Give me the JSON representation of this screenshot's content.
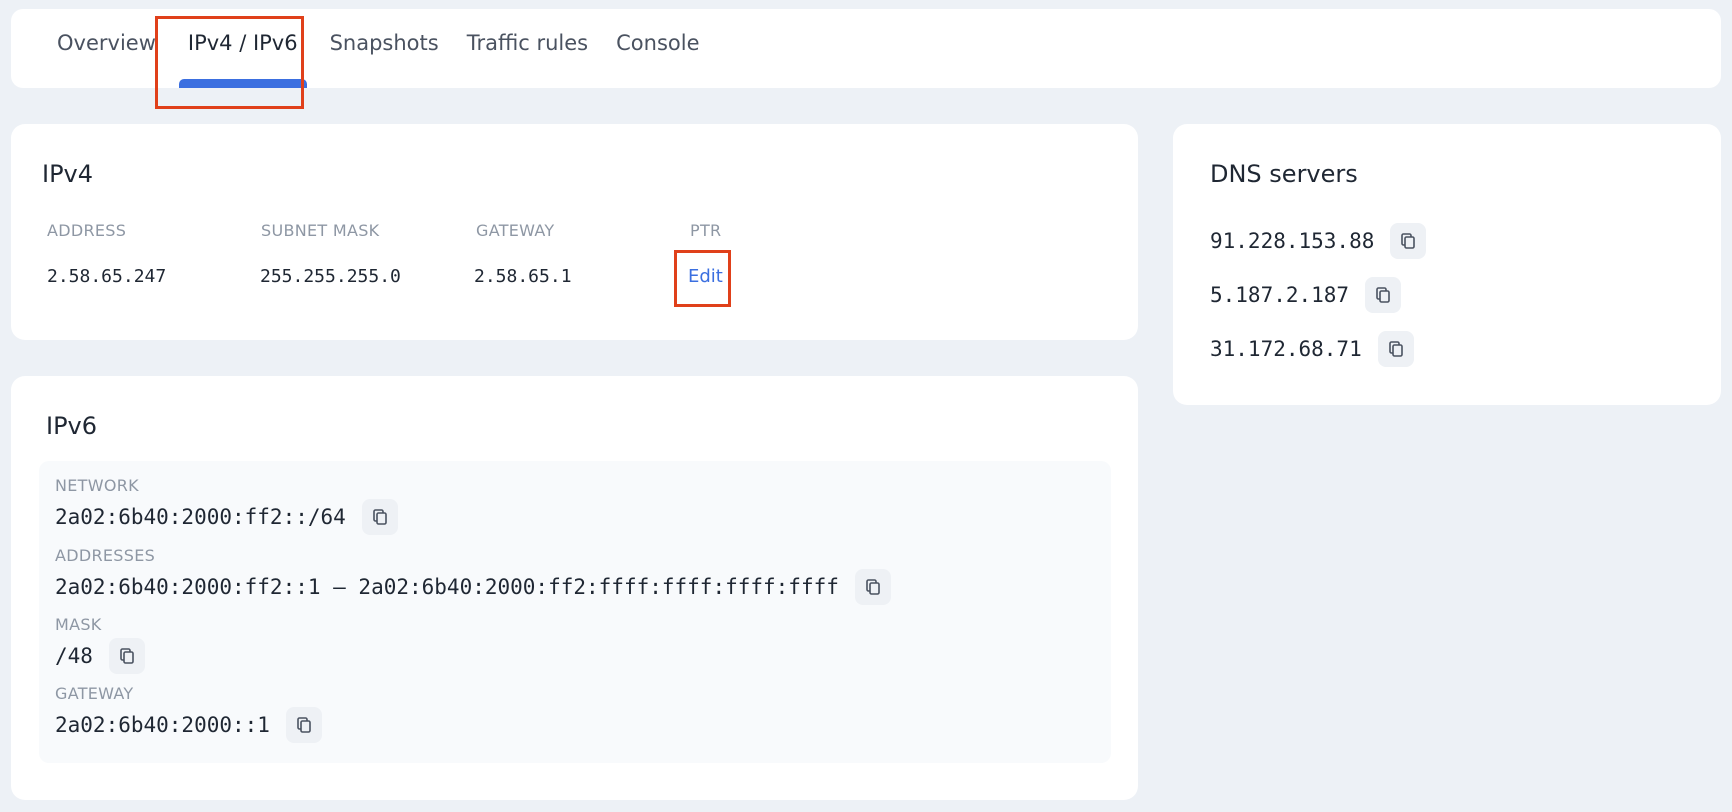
{
  "tabs": [
    {
      "label": "Overview",
      "active": false
    },
    {
      "label": "IPv4 / IPv6",
      "active": true
    },
    {
      "label": "Snapshots",
      "active": false
    },
    {
      "label": "Traffic rules",
      "active": false
    },
    {
      "label": "Console",
      "active": false
    }
  ],
  "ipv4": {
    "title": "IPv4",
    "headers": {
      "address": "ADDRESS",
      "subnet": "SUBNET MASK",
      "gateway": "GATEWAY",
      "ptr": "PTR"
    },
    "values": {
      "address": "2.58.65.247",
      "subnet": "255.255.255.0",
      "gateway": "2.58.65.1"
    },
    "ptr_action": "Edit"
  },
  "ipv6": {
    "title": "IPv6",
    "fields": [
      {
        "label": "NETWORK",
        "value": "2a02:6b40:2000:ff2::/64"
      },
      {
        "label": "ADDRESSES",
        "value": "2a02:6b40:2000:ff2::1 – 2a02:6b40:2000:ff2:ffff:ffff:ffff:ffff"
      },
      {
        "label": "MASK",
        "value": "/48"
      },
      {
        "label": "GATEWAY",
        "value": "2a02:6b40:2000::1"
      }
    ]
  },
  "dns": {
    "title": "DNS servers",
    "servers": [
      "91.228.153.88",
      "5.187.2.187",
      "31.172.68.71"
    ]
  },
  "icons": {
    "copy": "copy-icon"
  },
  "colors": {
    "accent": "#3b6fe0",
    "highlight": "#e0401a",
    "background": "#edf1f6"
  }
}
